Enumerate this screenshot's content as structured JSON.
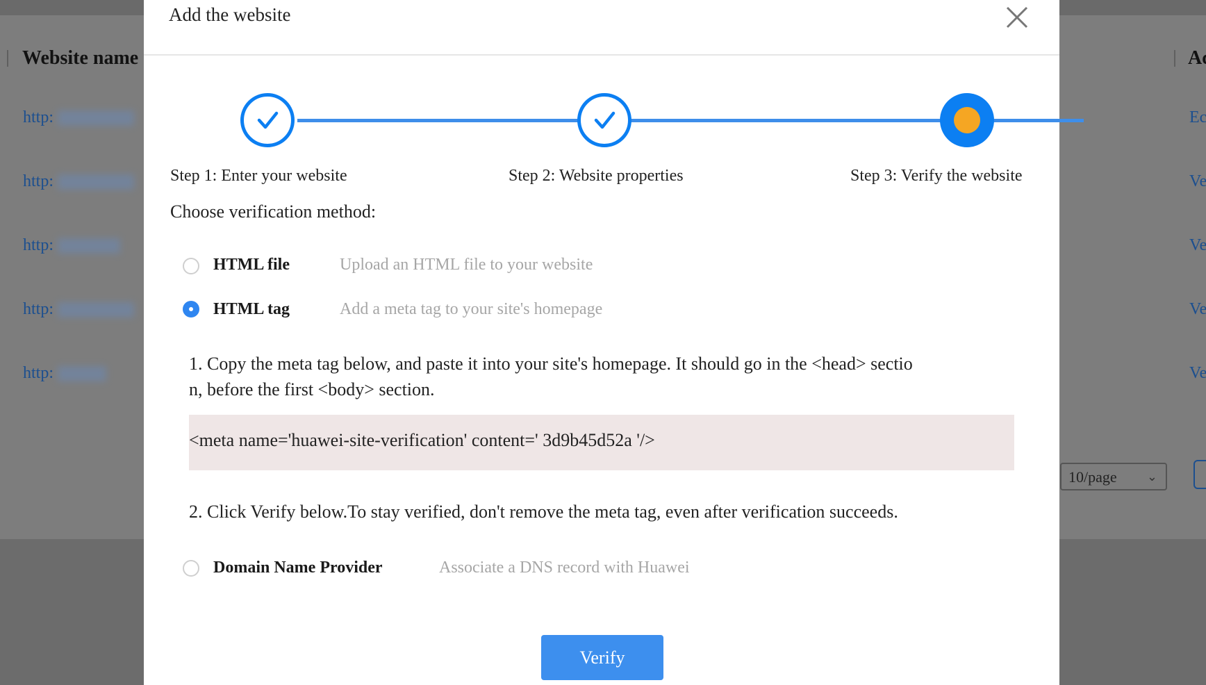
{
  "background": {
    "table_header": {
      "website_name": "Website name",
      "actions": "Ac"
    },
    "rows": [
      {
        "link_prefix": "http:",
        "action": "Ec"
      },
      {
        "link_prefix": "http:",
        "action": "Ve"
      },
      {
        "link_prefix": "http:",
        "action": "Ve"
      },
      {
        "link_prefix": "http:",
        "action": "Ve"
      },
      {
        "link_prefix": "http:",
        "action": "Ve"
      }
    ],
    "pagination": {
      "page_size": "10/page"
    }
  },
  "dialog": {
    "title": "Add the website",
    "steps": [
      {
        "label": "Step 1: Enter your website",
        "state": "done"
      },
      {
        "label": "Step 2: Website properties",
        "state": "done"
      },
      {
        "label": "Step 3: Verify the website",
        "state": "current"
      }
    ],
    "choose_label": "Choose verification method:",
    "options": [
      {
        "name": "HTML file",
        "description": "Upload an HTML file to your website",
        "selected": false
      },
      {
        "name": "HTML tag",
        "description": "Add a meta tag to your site's homepage",
        "selected": true
      },
      {
        "name": "Domain Name Provider",
        "description": "Associate a DNS record with Huawei",
        "selected": false
      }
    ],
    "instruction_1_line1": "1. Copy the meta tag below, and paste it into your site's homepage. It should go in the <head> sectio",
    "instruction_1_line2": "n, before the first <body> section.",
    "meta_tag": "<meta name='huawei-site-verification' content=' 3d9b45d52a '/>",
    "instruction_2": "2. Click Verify below.To stay verified, don't remove the meta tag, even after verification succeeds.",
    "verify_label": "Verify"
  },
  "colors": {
    "accent": "#0c7ff2",
    "current_step_dot": "#f5a623",
    "code_background": "#efe6e6",
    "button": "#3d8fee"
  },
  "icons": {
    "close": "close-icon",
    "step_done": "check-icon",
    "step_current": "dot-icon",
    "dropdown": "chevron-down-icon"
  }
}
